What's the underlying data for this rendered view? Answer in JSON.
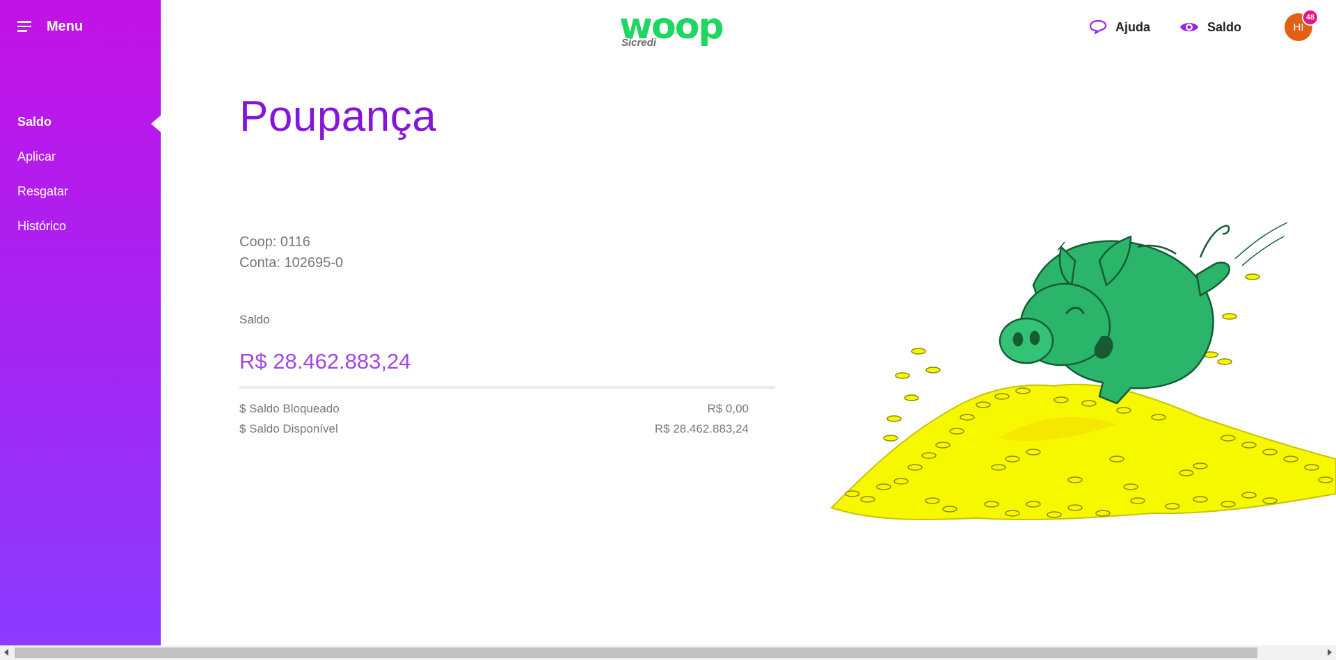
{
  "sidebar": {
    "menu_label": "Menu",
    "items": [
      {
        "label": "Saldo",
        "active": true
      },
      {
        "label": "Aplicar",
        "active": false
      },
      {
        "label": "Resgatar",
        "active": false
      },
      {
        "label": "Histórico",
        "active": false
      }
    ]
  },
  "header": {
    "logo_main": "woop",
    "logo_sub": "Sicredi",
    "help_label": "Ajuda",
    "balance_label": "Saldo",
    "avatar_initials": "HI",
    "notification_count": "48"
  },
  "main": {
    "title": "Poupança",
    "coop": "Coop: 0116",
    "account": "Conta: 102695-0",
    "balance_label": "Saldo",
    "balance_value": "R$ 28.462.883,24",
    "details": [
      {
        "label": "$ Saldo Bloqueado",
        "value": "R$ 0,00"
      },
      {
        "label": "$ Saldo Disponível",
        "value": "R$ 28.462.883,24"
      }
    ]
  },
  "colors": {
    "sidebar_top": "#c312e6",
    "sidebar_bottom": "#8b3cff",
    "title": "#8415d9",
    "balance": "#a245e8",
    "logo": "#1ed760",
    "avatar": "#e06016",
    "badge": "#e8177d",
    "pig": "#2bb56a",
    "coins": "#f7f700"
  },
  "icons": {
    "menu": "hamburger-icon",
    "help": "chat-bubble-icon",
    "balance": "eye-icon"
  }
}
